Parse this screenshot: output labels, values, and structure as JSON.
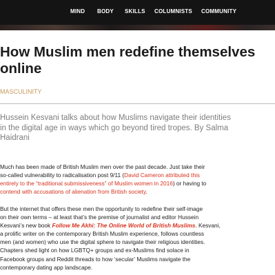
{
  "nav": {
    "items": [
      "MIND",
      "BODY",
      "SKILLS",
      "COLUMNISTS",
      "COMMUNITY"
    ]
  },
  "article": {
    "headline_line1": "How Muslim men redefine themselves",
    "headline_line2": "online",
    "category": "MASCULINITY",
    "standfirst": "Hussein Kesvani talks about how Muslims navigate their identities in the digital age in ways which go beyond tired tropes. By Salma Haidrani",
    "para1": {
      "l1": "Much has been made of British Muslim men over the past decade. Just take their",
      "l2_a": "so-called vulnerability to radicalisation post 9/11 (",
      "l2_link": "David Cameron attributed this",
      "l3_link": "entirely to the “traditional submissiveness” of Muslim women in 2016",
      "l3_b": ") or having to",
      "l4_link": "contend with accusations of alienation from British society",
      "l4_b": "."
    },
    "para2": {
      "l1": "But the internet that offers these men the opportunity to redefine their self-image",
      "l2": "on their own terms – at least that’s the premise of journalist and editor Hussein",
      "l3_a": "Kesvani’s new book ",
      "l3_link": "Follow Me Akhi: The Online World of British Muslims",
      "l3_b": ". Kesvani,",
      "l4": "a prolific writer on the contemporary British Muslim experience, follows countless",
      "l5": "men (and women) who use the digital sphere to navigate their religious identities.",
      "l6": "Chapters shed light on how LGBTQ+ groups and ex-Muslims find solace in",
      "l7": "Facebook groups and Reddit threads to how ‘secular’ Muslims navigate the",
      "l8": "contemporary dating app landscape."
    }
  },
  "colors": {
    "nav_background": "#141414",
    "category": "#c79a5b",
    "link": "#d6341f",
    "standfirst": "#7d7d7d"
  }
}
